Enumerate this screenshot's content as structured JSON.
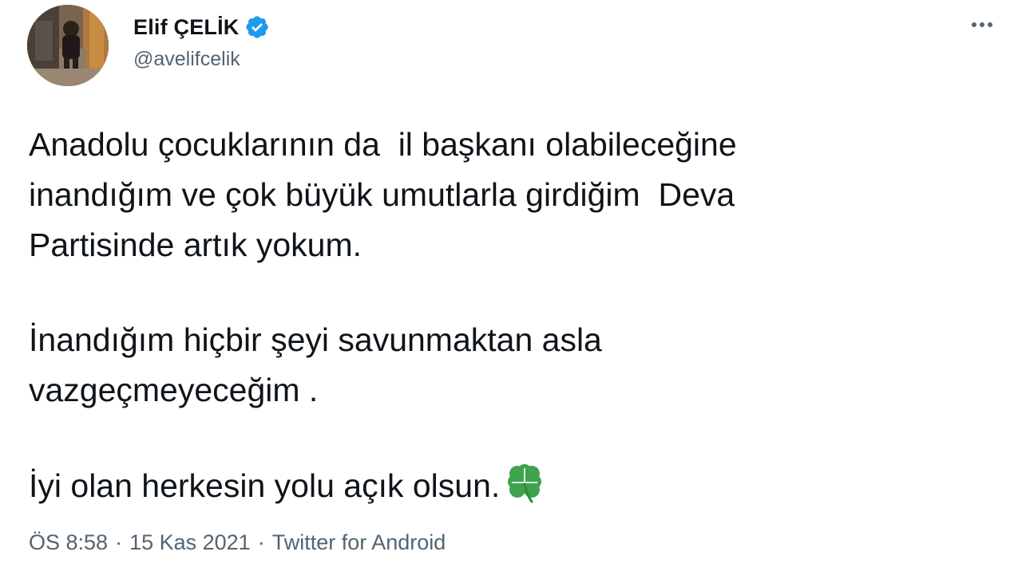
{
  "author": {
    "display_name": "Elif ÇELİK",
    "handle": "@avelifcelik",
    "verified_icon": "verified-badge-icon",
    "avatar": "profile-photo"
  },
  "menu": {
    "icon": "more-options-icon"
  },
  "tweet": {
    "paragraphs": [
      "Anadolu çocuklarının da  il başkanı olabileceğine\ninandığım ve çok büyük umutlarla girdiğim  Deva\nPartisinde artık yokum.",
      "İnandığım hiçbir şeyi savunmaktan asla\nvazgeçmeyeceğim .",
      "İyi olan herkesin yolu açık olsun."
    ],
    "emoji": "four-leaf-clover-icon"
  },
  "meta": {
    "time": "ÖS 8:58",
    "date": "15 Kas 2021",
    "source": "Twitter for Android",
    "separator": "·"
  },
  "colors": {
    "text": "#0f1419",
    "secondary": "#536471",
    "verified": "#1d9bf0",
    "clover": "#3fa34d"
  }
}
